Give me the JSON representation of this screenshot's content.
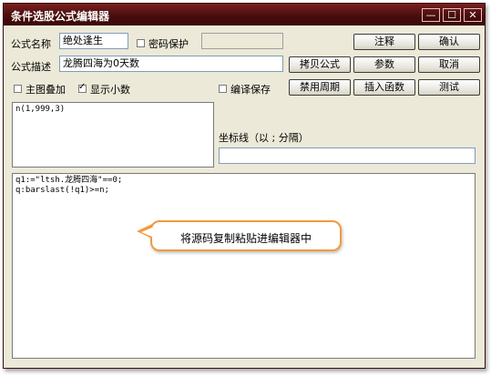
{
  "window": {
    "title": "条件选股公式编辑器"
  },
  "titlebar_buttons": [
    "—",
    "☐",
    "✕"
  ],
  "form": {
    "name_label": "公式名称",
    "name_value": "绝处逢生",
    "password_label": "密码保护",
    "desc_label": "公式描述",
    "desc_value": "龙腾四海为0天数",
    "main_overlay_label": "主图叠加",
    "show_decimal_label": "显示小数",
    "compile_save_label": "编译保存",
    "param_text": "n(1,999,3)",
    "coord_label": "坐标线（以 ; 分隔）",
    "coord_value": ""
  },
  "checkboxes": {
    "password": false,
    "main_overlay": false,
    "show_decimal": true,
    "compile_save": false
  },
  "buttons": {
    "annotate": "注释",
    "confirm": "确认",
    "copy_formula": "拷贝公式",
    "params": "参数",
    "cancel": "取消",
    "disable_period": "禁用周期",
    "insert_function": "插入函数",
    "test": "测试"
  },
  "editor": {
    "line1": "q1:=\"ltsh.龙腾四海\"==0;",
    "line2": "q:barslast(!q1)>=n;"
  },
  "callout": {
    "text": "将源码复制粘贴进编辑器中"
  },
  "colors": {
    "titlebar": "#5a1010",
    "callout_border": "#f39a3e",
    "window_bg": "#ece9d8"
  }
}
